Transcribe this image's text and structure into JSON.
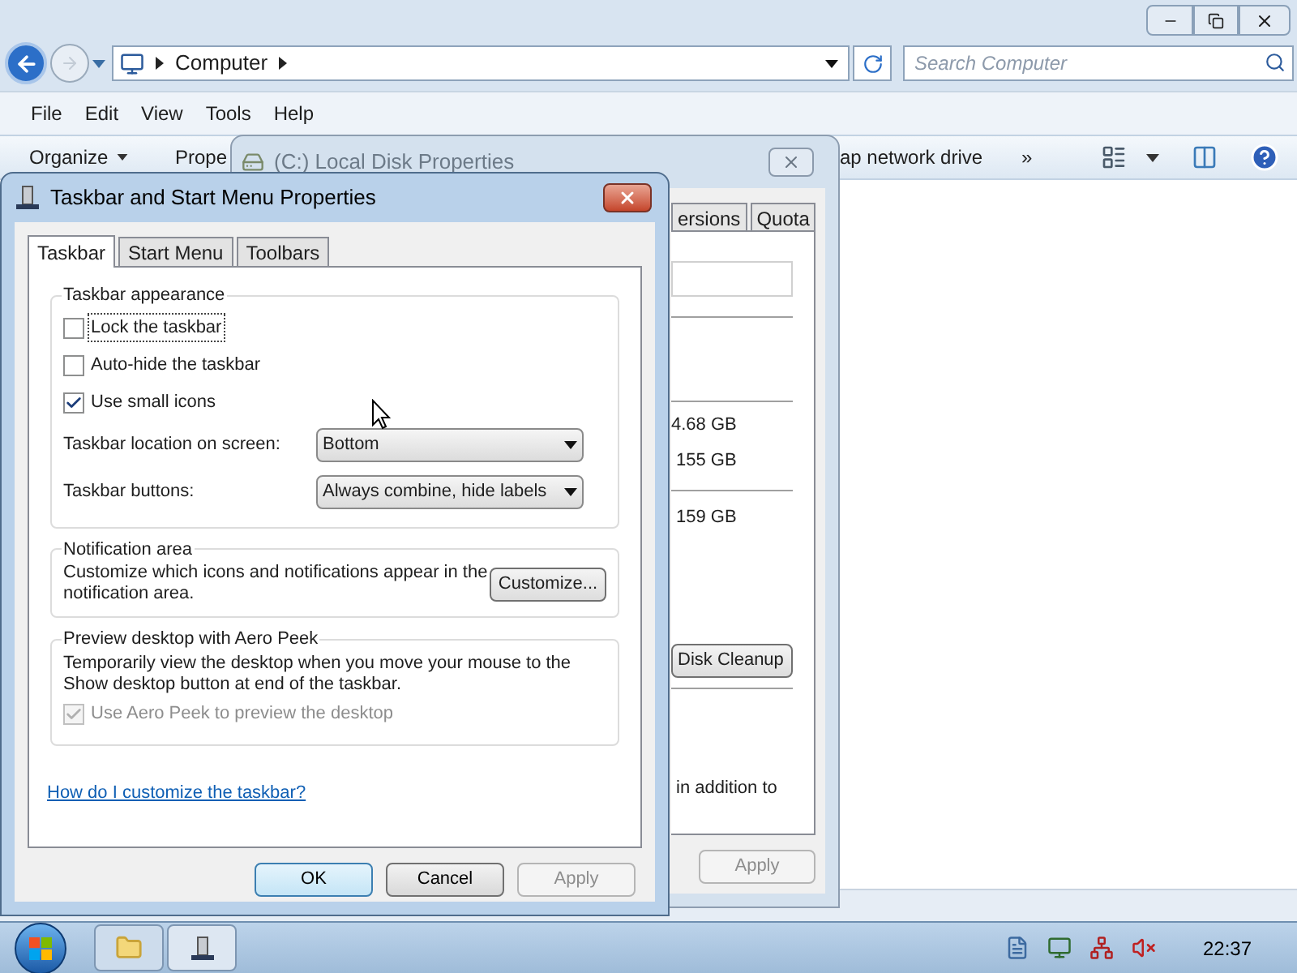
{
  "explorer": {
    "address": {
      "location": "Computer"
    },
    "search": {
      "placeholder": "Search Computer"
    },
    "menu": [
      "File",
      "Edit",
      "View",
      "Tools",
      "Help"
    ],
    "toolbar": [
      {
        "label": "Organize",
        "kind": "dropdown"
      },
      {
        "label": "Prope",
        "kind": "plain"
      },
      {
        "label": "ap network drive",
        "kind": "plain"
      },
      {
        "label": "»",
        "kind": "plain"
      }
    ]
  },
  "disk_dialog": {
    "title": "(C:) Local Disk Properties",
    "tabs": [
      {
        "label": "ersions",
        "selected": false
      },
      {
        "label": "Quota",
        "selected": false
      }
    ],
    "sizes": [
      "4.68 GB",
      "155 GB",
      "159 GB"
    ],
    "cleanup_button": "Disk Cleanup",
    "note": "in addition to",
    "apply_button": {
      "label": "Apply",
      "disabled": true
    }
  },
  "taskbar_dialog": {
    "title": "Taskbar and Start Menu Properties",
    "tabs": [
      {
        "label": "Taskbar",
        "selected": true
      },
      {
        "label": "Start Menu",
        "selected": false
      },
      {
        "label": "Toolbars",
        "selected": false
      }
    ],
    "groups": [
      {
        "title": "Taskbar appearance",
        "items": [
          {
            "kind": "checkbox",
            "label": "Lock the taskbar",
            "checked": false,
            "focused": true,
            "disabled": false
          },
          {
            "kind": "checkbox",
            "label": "Auto-hide the taskbar",
            "checked": false,
            "focused": false,
            "disabled": false
          },
          {
            "kind": "checkbox",
            "label": "Use small icons",
            "checked": true,
            "focused": false,
            "disabled": false
          },
          {
            "kind": "dropdown",
            "label": "Taskbar location on screen:",
            "value": "Bottom"
          },
          {
            "kind": "dropdown",
            "label": "Taskbar buttons:",
            "value": "Always combine, hide labels"
          }
        ]
      },
      {
        "title": "Notification area",
        "items": [
          {
            "kind": "text_button",
            "text": "Customize which icons and notifications appear in the notification area.",
            "button": "Customize..."
          }
        ]
      },
      {
        "title": "Preview desktop with Aero Peek",
        "items": [
          {
            "kind": "text",
            "text": "Temporarily view the desktop when you move your mouse to the Show desktop button at end of the taskbar."
          },
          {
            "kind": "checkbox",
            "label": "Use Aero Peek to preview the desktop",
            "checked": true,
            "focused": false,
            "disabled": true
          }
        ]
      }
    ],
    "help_link": "How do I customize the taskbar?",
    "buttons": [
      {
        "label": "OK",
        "default": true,
        "disabled": false
      },
      {
        "label": "Cancel",
        "default": false,
        "disabled": false
      },
      {
        "label": "Apply",
        "default": false,
        "disabled": true
      }
    ]
  },
  "taskbar": {
    "clock": "22:37"
  }
}
